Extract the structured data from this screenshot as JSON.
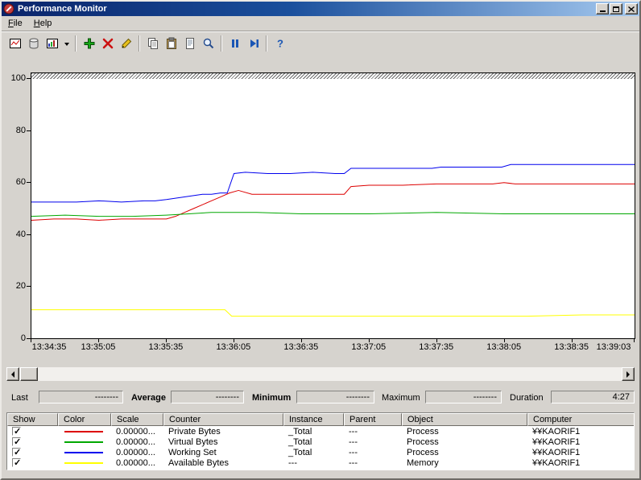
{
  "window": {
    "title": "Performance Monitor"
  },
  "menu": {
    "items": [
      {
        "label": "File"
      },
      {
        "label": "Help"
      }
    ]
  },
  "toolbar": {
    "icons": [
      "view-current-activity",
      "view-log-data",
      "change-graph-type",
      "graph-type-dropdown",
      "add-counter",
      "delete-counter",
      "highlight",
      "copy-properties",
      "paste-counter-list",
      "properties",
      "zoom",
      "freeze-display",
      "update-data",
      "help"
    ],
    "help_glyph": "?"
  },
  "chart_data": {
    "type": "line",
    "title": "",
    "xlabel": "",
    "ylabel": "",
    "ylim": [
      0,
      100
    ],
    "yticks": [
      0,
      20,
      40,
      60,
      80,
      100
    ],
    "grid": false,
    "legend_position": "table-below",
    "x_axis_labels": [
      "13:34:35",
      "13:35:05",
      "13:35:35",
      "13:36:05",
      "13:36:35",
      "13:37:05",
      "13:37:35",
      "13:38:05",
      "13:38:35",
      "13:39:03"
    ],
    "x_label_seconds": [
      0,
      30,
      60,
      90,
      120,
      150,
      180,
      210,
      240,
      268
    ],
    "x_range_seconds": [
      0,
      268
    ],
    "series": [
      {
        "name": "Private Bytes",
        "color": "#dd0000",
        "x": [
          0,
          10,
          20,
          30,
          40,
          50,
          60,
          64,
          68,
          72,
          76,
          80,
          84,
          88,
          92,
          98,
          110,
          125,
          136,
          139,
          142,
          150,
          165,
          180,
          195,
          205,
          210,
          215,
          230,
          245,
          268
        ],
        "y": [
          45.5,
          46,
          46,
          45.5,
          46,
          46,
          46,
          47,
          48.5,
          50,
          51.5,
          53,
          54.5,
          56,
          57,
          55.5,
          55.5,
          55.5,
          55.5,
          55.5,
          58.5,
          59,
          59,
          59.5,
          59.5,
          59.5,
          60,
          59.5,
          59.5,
          59.5,
          59.5
        ]
      },
      {
        "name": "Virtual Bytes",
        "color": "#00a800",
        "x": [
          0,
          15,
          30,
          45,
          60,
          70,
          80,
          90,
          100,
          120,
          150,
          180,
          210,
          240,
          268
        ],
        "y": [
          47,
          47.5,
          47,
          47,
          47.5,
          48,
          48.5,
          48.5,
          48.5,
          48,
          48,
          48.5,
          48,
          48,
          48
        ]
      },
      {
        "name": "Working Set",
        "color": "#0000ee",
        "x": [
          0,
          10,
          20,
          30,
          40,
          50,
          55,
          60,
          64,
          68,
          72,
          76,
          80,
          84,
          87,
          90,
          95,
          105,
          115,
          125,
          135,
          139,
          142,
          150,
          160,
          170,
          178,
          182,
          195,
          205,
          209,
          213,
          225,
          240,
          255,
          268
        ],
        "y": [
          52.5,
          52.5,
          52.5,
          53,
          52.5,
          53,
          53,
          53.5,
          54,
          54.5,
          55,
          55.5,
          55.5,
          56,
          56,
          63.5,
          64,
          63.5,
          63.5,
          64,
          63.5,
          63.5,
          65.5,
          65.5,
          65.5,
          65.5,
          65.5,
          66,
          66,
          66,
          66,
          67,
          67,
          67,
          67,
          67
        ]
      },
      {
        "name": "Available Bytes",
        "color": "#ffff00",
        "x": [
          0,
          20,
          40,
          60,
          80,
          86,
          89,
          95,
          110,
          130,
          160,
          190,
          220,
          245,
          268
        ],
        "y": [
          11,
          11,
          11,
          11,
          11,
          11,
          8.5,
          8.5,
          8.5,
          8.5,
          8.5,
          8.5,
          8.5,
          9,
          9
        ]
      }
    ]
  },
  "stats": {
    "last_label": "Last",
    "last_value": "--------",
    "average_label": "Average",
    "average_value": "--------",
    "minimum_label": "Minimum",
    "minimum_value": "--------",
    "maximum_label": "Maximum",
    "maximum_value": "--------",
    "duration_label": "Duration",
    "duration_value": "4:27"
  },
  "table": {
    "headers": [
      "Show",
      "Color",
      "Scale",
      "Counter",
      "Instance",
      "Parent",
      "Object",
      "Computer"
    ],
    "rows": [
      {
        "show": true,
        "color": "#dd0000",
        "scale": "0.00000...",
        "counter": "Private Bytes",
        "instance": "_Total",
        "parent": "---",
        "object": "Process",
        "computer": "¥¥KAORIF1"
      },
      {
        "show": true,
        "color": "#00a800",
        "scale": "0.00000...",
        "counter": "Virtual Bytes",
        "instance": "_Total",
        "parent": "---",
        "object": "Process",
        "computer": "¥¥KAORIF1"
      },
      {
        "show": true,
        "color": "#0000ee",
        "scale": "0.00000...",
        "counter": "Working Set",
        "instance": "_Total",
        "parent": "---",
        "object": "Process",
        "computer": "¥¥KAORIF1"
      },
      {
        "show": true,
        "color": "#ffff00",
        "scale": "0.00000...",
        "counter": "Available Bytes",
        "instance": "---",
        "parent": "---",
        "object": "Memory",
        "computer": "¥¥KAORIF1"
      }
    ]
  }
}
